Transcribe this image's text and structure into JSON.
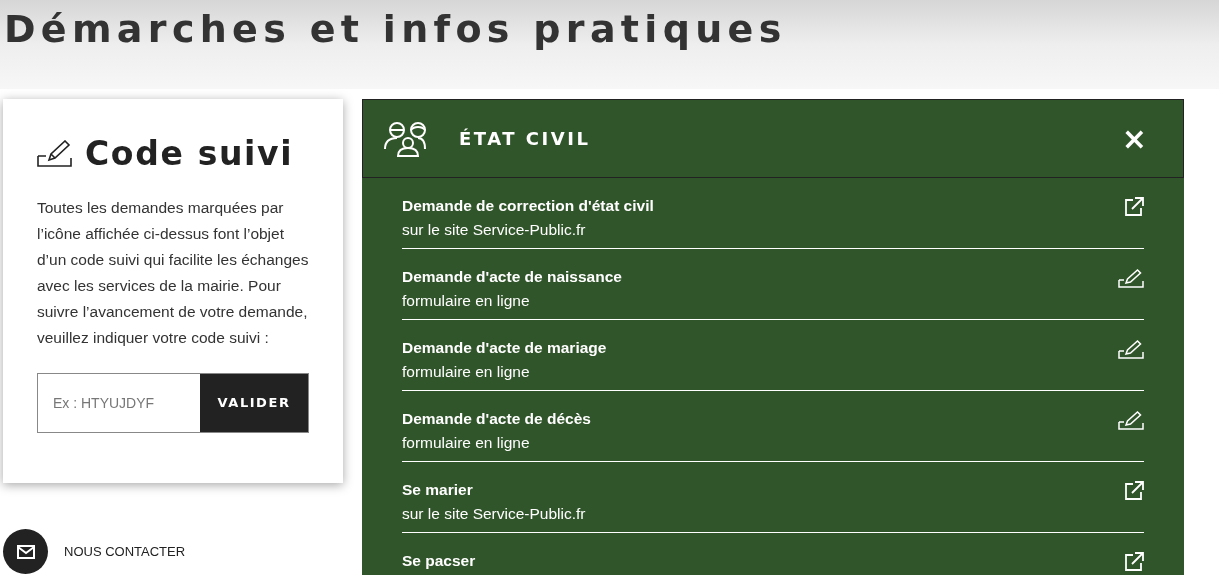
{
  "page_title": "Démarches et infos pratiques",
  "code_card": {
    "title": "Code suivi",
    "text": "Toutes les demandes marquées par l’icône affichée ci-dessus font l’objet d’un code suivi qui facilite les échanges avec les services de la mairie. Pour suivre l’avancement de votre demande, veuillez indiquer votre code suivi :",
    "placeholder": "Ex : HTYUJDYF",
    "button": "VALIDER"
  },
  "contact": {
    "label": "NOUS CONTACTER"
  },
  "section": {
    "title": "ÉTAT CIVIL",
    "expanded": true,
    "close": "×",
    "items": [
      {
        "kind": "external",
        "title": "Demande de correction d'état civil",
        "subtitle": "sur le site Service-Public.fr"
      },
      {
        "kind": "form",
        "title": "Demande d'acte de naissance",
        "subtitle": "formulaire en ligne"
      },
      {
        "kind": "form",
        "title": "Demande d'acte de mariage",
        "subtitle": "formulaire en ligne"
      },
      {
        "kind": "form",
        "title": "Demande d'acte de décès",
        "subtitle": "formulaire en ligne"
      },
      {
        "kind": "external",
        "title": "Se marier",
        "subtitle": "sur le site Service-Public.fr"
      },
      {
        "kind": "external",
        "title": "Se pacser"
      }
    ]
  }
}
